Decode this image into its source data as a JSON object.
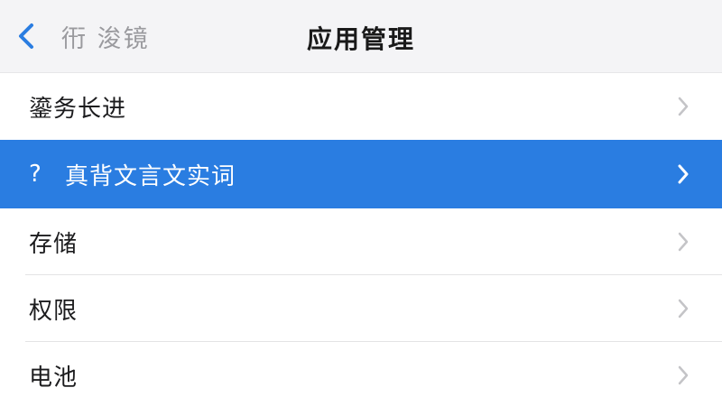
{
  "navbar": {
    "back_label": "衎 浚镜",
    "title": "应用管理"
  },
  "rows": [
    {
      "label": "鎏务长进"
    },
    {
      "prefix": "?",
      "label": "真背文言文实词"
    },
    {
      "label": "存储"
    },
    {
      "label": "权限"
    },
    {
      "label": "电池"
    }
  ],
  "colors": {
    "accent": "#2a7de1",
    "chevron": "#c4c4c7",
    "nav_background": "#f4f4f6"
  }
}
